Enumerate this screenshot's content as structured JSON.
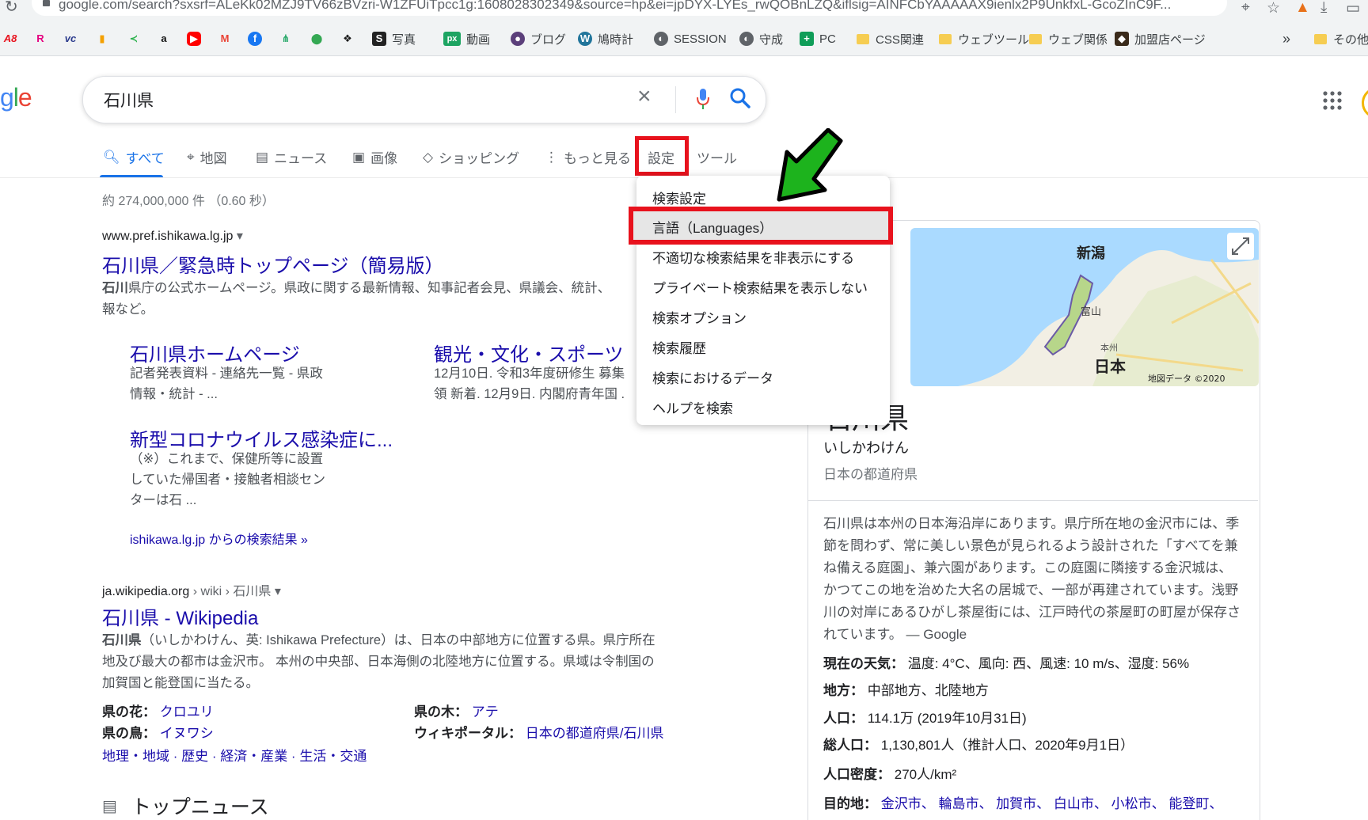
{
  "browser": {
    "url": "google.com/search?sxsrf=ALeKk02MZJ9TV66zBVzri-W1ZFUiTpcc1g:1608028302349&source=hp&ei=jpDYX-LYEs_rwQOBnLZQ&iflsig=AINFCbYAAAAAX9ienlx2P9UnkfxL-GcoZInC9F...",
    "bookmarks": [
      {
        "label": "",
        "icon": "a8-icon"
      },
      {
        "label": "",
        "icon": "r-icon"
      },
      {
        "label": "",
        "icon": "vc-icon"
      },
      {
        "label": "",
        "icon": "analytics-icon"
      },
      {
        "label": "",
        "icon": "feedly-icon"
      },
      {
        "label": "",
        "icon": "amazon-icon"
      },
      {
        "label": "",
        "icon": "youtube-icon"
      },
      {
        "label": "",
        "icon": "gmail-icon"
      },
      {
        "label": "",
        "icon": "facebook-icon"
      },
      {
        "label": "",
        "icon": "app-icon"
      },
      {
        "label": "",
        "icon": "maps-icon"
      },
      {
        "label": "",
        "icon": "dropbox-icon"
      },
      {
        "label": "写真",
        "icon": "photo-icon"
      },
      {
        "label": "動画",
        "icon": "px-icon"
      },
      {
        "label": "ブログ",
        "icon": "blog-icon"
      },
      {
        "label": "鳩時計",
        "icon": "wordpress-icon"
      },
      {
        "label": "SESSION",
        "icon": "globe-icon"
      },
      {
        "label": "守成",
        "icon": "globe-icon"
      },
      {
        "label": "PC",
        "icon": "plus-icon"
      },
      {
        "label": "CSS関連",
        "icon": "folder-icon"
      },
      {
        "label": "ウェブツール",
        "icon": "folder-icon"
      },
      {
        "label": "ウェブ関係",
        "icon": "folder-icon"
      },
      {
        "label": "加盟店ページ",
        "icon": "store-icon"
      }
    ],
    "more": "»",
    "other": "その他"
  },
  "search": {
    "query": "石川県"
  },
  "tabs": [
    {
      "label": "すべて",
      "icon": "search-icon"
    },
    {
      "label": "地図",
      "icon": "pin-icon"
    },
    {
      "label": "ニュース",
      "icon": "news-icon"
    },
    {
      "label": "画像",
      "icon": "image-icon"
    },
    {
      "label": "ショッピング",
      "icon": "tag-icon"
    },
    {
      "label": "もっと見る",
      "icon": "more-icon"
    },
    {
      "label": "設定",
      "icon": ""
    },
    {
      "label": "ツール",
      "icon": ""
    }
  ],
  "stats": "約 274,000,000 件 （0.60 秒）",
  "results": [
    {
      "cite": "www.pref.ishikawa.lg.jp",
      "title": "石川県／緊急時トップページ（簡易版）",
      "snippet_bold": "石川",
      "snippet": "県庁の公式ホームページ。県政に関する最新情報、知事記者会見、県議会、統計、",
      "snippet2": "報など。",
      "sitelinks": [
        {
          "title": "石川県ホームページ",
          "line1": "記者発表資料 - 連絡先一覧 - 県政",
          "line2": "情報・統計 - ..."
        },
        {
          "title": "観光・文化・スポーツ",
          "line1": "12月10日. 令和3年度研修生 募集",
          "line2": "領 新着. 12月9日. 内閣府青年国 ."
        },
        {
          "title": "新型コロナウイルス感染症に...",
          "line1": "（※）これまで、保健所等に設置",
          "line2": "していた帰国者・接触者相談セン",
          "line3": "ターは石 ..."
        }
      ],
      "more_link": "ishikawa.lg.jp からの検索結果 »"
    },
    {
      "cite": "ja.wikipedia.org",
      "cite_path": "› wiki › 石川県",
      "title": "石川県 - Wikipedia",
      "snippet_bold": "石川県",
      "snippet": "（いしかわけん、英: Ishikawa Prefecture）は、日本の中部地方に位置する県。県庁所在",
      "snippet2": "地及び最大の都市は金沢市。 本州の中央部、日本海側の北陸地方に位置する。県域は令制国の",
      "snippet3": "加賀国と能登国に当たる。",
      "facts": [
        {
          "label": "県の花：",
          "value": "クロユリ"
        },
        {
          "label": "県の木：",
          "value": "アテ"
        },
        {
          "label": "県の鳥：",
          "value": "イヌワシ"
        },
        {
          "label": "ウィキポータル：",
          "value": "日本の都道府県/石川県"
        }
      ],
      "links": "地理・地域 · 歴史 · 経済・産業 · 生活・交通"
    }
  ],
  "top_news": "トップニュース",
  "knowledge_panel": {
    "name": "石川県",
    "reading": "いしかわけん",
    "type": "日本の都道府県",
    "map_labels": [
      "新潟",
      "富山",
      "本州",
      "日本",
      "地図データ ©2020"
    ],
    "description": "石川県は本州の日本海沿岸にあります。県庁所在地の金沢市には、季節を問わず、常に美しい景色が見られるよう設計された「すべてを兼ね備える庭園」、兼六園があります。この庭園に隣接する金沢城は、かつてこの地を治めた大名の居城で、一部が再建されています。浅野川の対岸にあるひがし茶屋街には、江戸時代の茶屋町の町屋が保存されています。",
    "description_source": "— Google",
    "facts": [
      {
        "label": "現在の天気：",
        "value": "温度: 4°C、風向: 西、風速: 10 m/s、湿度: 56%"
      },
      {
        "label": "地方：",
        "value": "中部地方、北陸地方"
      },
      {
        "label": "人口：",
        "value": "114.1万 (2019年10月31日)"
      },
      {
        "label": "総人口：",
        "value": "1,130,801人（推計人口、2020年9月1日）"
      },
      {
        "label": "人口密度：",
        "value": "270人/km²"
      },
      {
        "label": "目的地：",
        "value": "金沢市、 輪島市、 加賀市、 白山市、 小松市、 能登町、"
      }
    ]
  },
  "settings_menu": {
    "items": [
      "検索設定",
      "言語（Languages）",
      "不適切な検索結果を非表示にする",
      "プライベート検索結果を表示しない",
      "検索オプション",
      "検索履歴",
      "検索におけるデータ",
      "ヘルプを検索"
    ],
    "highlighted_index": 1
  },
  "colors": {
    "link": "#1a0dab",
    "accent": "#1a73e8",
    "annotation_red": "#e8121d",
    "annotation_green": "#1db31d"
  }
}
